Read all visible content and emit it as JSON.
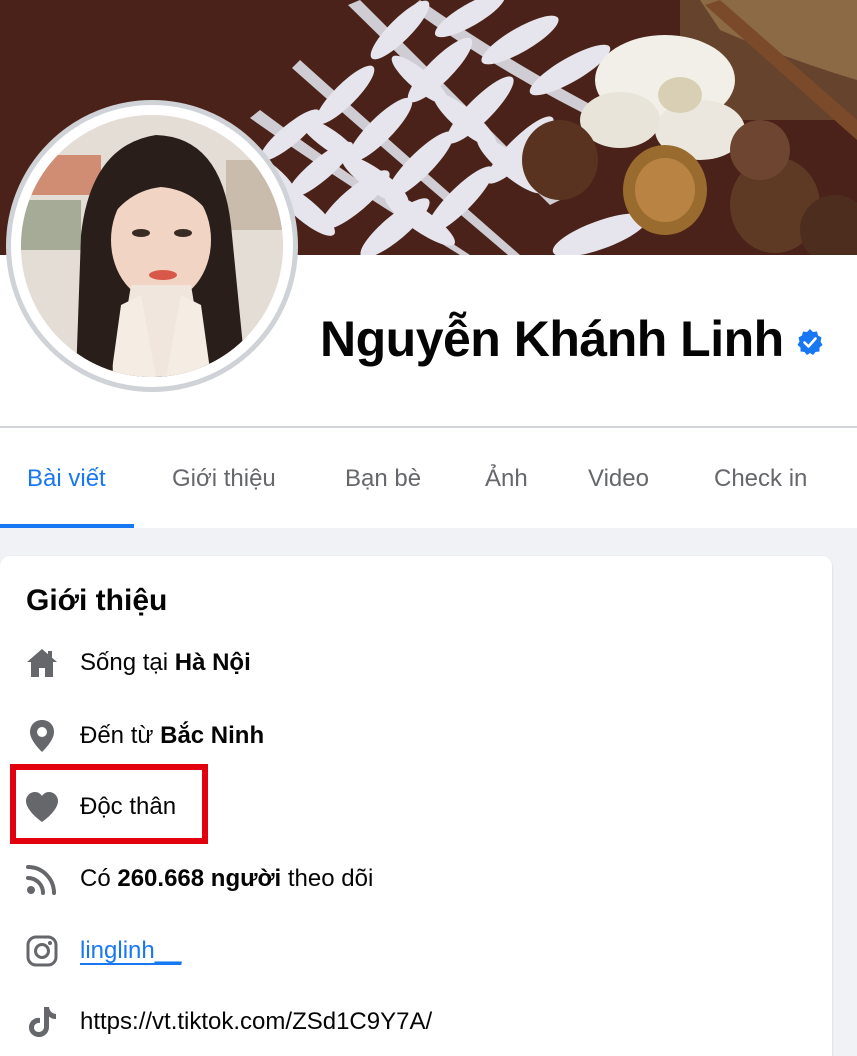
{
  "profile": {
    "name": "Nguyễn Khánh Linh",
    "verified": true
  },
  "tabs": [
    {
      "label": "Bài viết",
      "active": true
    },
    {
      "label": "Giới thiệu",
      "active": false
    },
    {
      "label": "Bạn bè",
      "active": false
    },
    {
      "label": "Ảnh",
      "active": false
    },
    {
      "label": "Video",
      "active": false
    },
    {
      "label": "Check in",
      "active": false
    }
  ],
  "intro": {
    "title": "Giới thiệu",
    "lives_in_prefix": "Sống tại ",
    "lives_in_city": "Hà Nội",
    "from_prefix": "Đến từ ",
    "from_city": "Bắc Ninh",
    "relationship": "Độc thân",
    "followers_prefix": "Có ",
    "followers_count": "260.668 người",
    "followers_suffix": " theo dõi",
    "instagram": "linglinh__",
    "tiktok": "https://vt.tiktok.com/ZSd1C9Y7A/"
  },
  "colors": {
    "accent": "#1877f2",
    "highlight": "#e3000f",
    "icon": "#65676b"
  }
}
